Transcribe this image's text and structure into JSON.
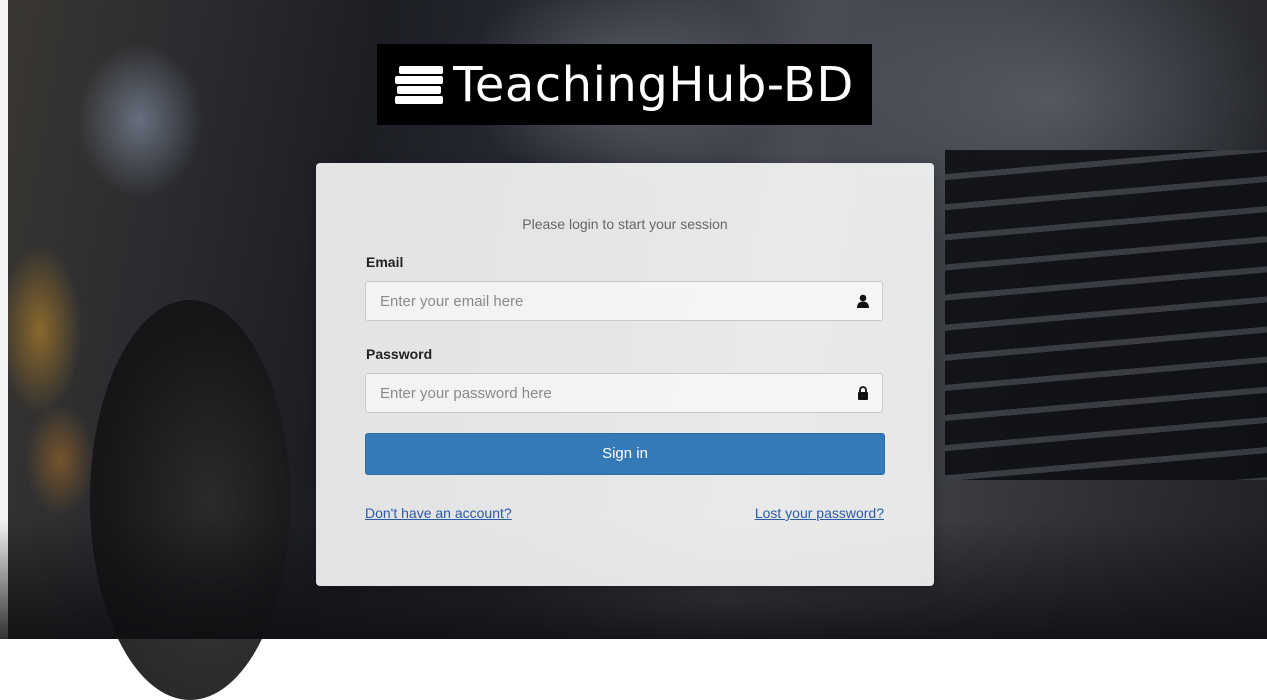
{
  "brand": {
    "logo_text": "TeachingHub-BD"
  },
  "login": {
    "subtitle": "Please login to start your session",
    "email_label": "Email",
    "email_placeholder": "Enter your email here",
    "password_label": "Password",
    "password_placeholder": "Enter your password here",
    "signin_label": "Sign in",
    "signup_link": "Don't have an account?",
    "forgot_link": "Lost your password?"
  },
  "icons": {
    "email": "user-icon",
    "password": "lock-icon",
    "logo": "books-icon"
  },
  "colors": {
    "primary_button": "#337ab7",
    "link": "#2a5aa8"
  }
}
